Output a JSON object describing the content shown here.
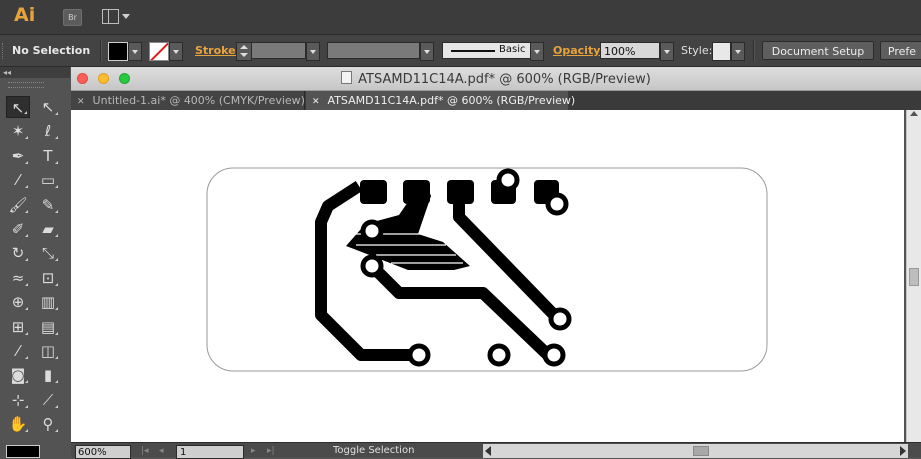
{
  "app": {
    "logo": "Ai",
    "bridge_label": "Br"
  },
  "control_bar": {
    "selection_status": "No Selection",
    "stroke_label": "Stroke:",
    "stroke_profile_label": "Basic",
    "opacity_label": "Opacity:",
    "opacity_value": "100%",
    "style_label": "Style:",
    "document_setup_label": "Document Setup",
    "preferences_label": "Prefe"
  },
  "tools_panel": {
    "collapse_glyph": "◂◂",
    "tools": [
      {
        "name": "selection-tool",
        "glyph": "↖"
      },
      {
        "name": "direct-selection-tool",
        "glyph": "↖"
      },
      {
        "name": "magic-wand-tool",
        "glyph": "✶"
      },
      {
        "name": "lasso-tool",
        "glyph": "ℓ"
      },
      {
        "name": "pen-tool",
        "glyph": "✒"
      },
      {
        "name": "type-tool",
        "glyph": "T"
      },
      {
        "name": "line-segment-tool",
        "glyph": "⁄"
      },
      {
        "name": "rectangle-tool",
        "glyph": "▭"
      },
      {
        "name": "paintbrush-tool",
        "glyph": "🖌"
      },
      {
        "name": "pencil-tool",
        "glyph": "✎"
      },
      {
        "name": "blob-brush-tool",
        "glyph": "✐"
      },
      {
        "name": "eraser-tool",
        "glyph": "▰"
      },
      {
        "name": "rotate-tool",
        "glyph": "↻"
      },
      {
        "name": "scale-tool",
        "glyph": "⤡"
      },
      {
        "name": "width-tool",
        "glyph": "≈"
      },
      {
        "name": "free-transform-tool",
        "glyph": "⊡"
      },
      {
        "name": "shape-builder-tool",
        "glyph": "⊕"
      },
      {
        "name": "perspective-grid-tool",
        "glyph": "▥"
      },
      {
        "name": "mesh-tool",
        "glyph": "⊞"
      },
      {
        "name": "gradient-tool",
        "glyph": "▤"
      },
      {
        "name": "eyedropper-tool",
        "glyph": "⁄"
      },
      {
        "name": "blend-tool",
        "glyph": "◫"
      },
      {
        "name": "symbol-sprayer-tool",
        "glyph": "◙"
      },
      {
        "name": "column-graph-tool",
        "glyph": "▮"
      },
      {
        "name": "artboard-tool",
        "glyph": "⊹"
      },
      {
        "name": "slice-tool",
        "glyph": "⟋"
      },
      {
        "name": "hand-tool",
        "glyph": "✋"
      },
      {
        "name": "zoom-tool",
        "glyph": "⚲"
      }
    ]
  },
  "document": {
    "window_title": "ATSAMD11C14A.pdf* @ 600% (RGB/Preview)",
    "tabs": [
      {
        "label": "Untitled-1.ai* @ 400% (CMYK/Preview)",
        "close": "✕",
        "active": false
      },
      {
        "label": "ATSAMD11C14A.pdf* @ 600% (RGB/Preview)",
        "close": "✕",
        "active": true
      }
    ]
  },
  "status_bar": {
    "zoom_value": "600%",
    "page_value": "1",
    "status_text": "Toggle Selection",
    "nav_first": "|◂",
    "nav_prev": "◂",
    "nav_next": "▸",
    "nav_last": "▸|"
  },
  "colors": {
    "app_bg": "#535353",
    "accent_orange": "#e8a33d",
    "canvas": "#ffffff",
    "artwork": "#000000"
  }
}
